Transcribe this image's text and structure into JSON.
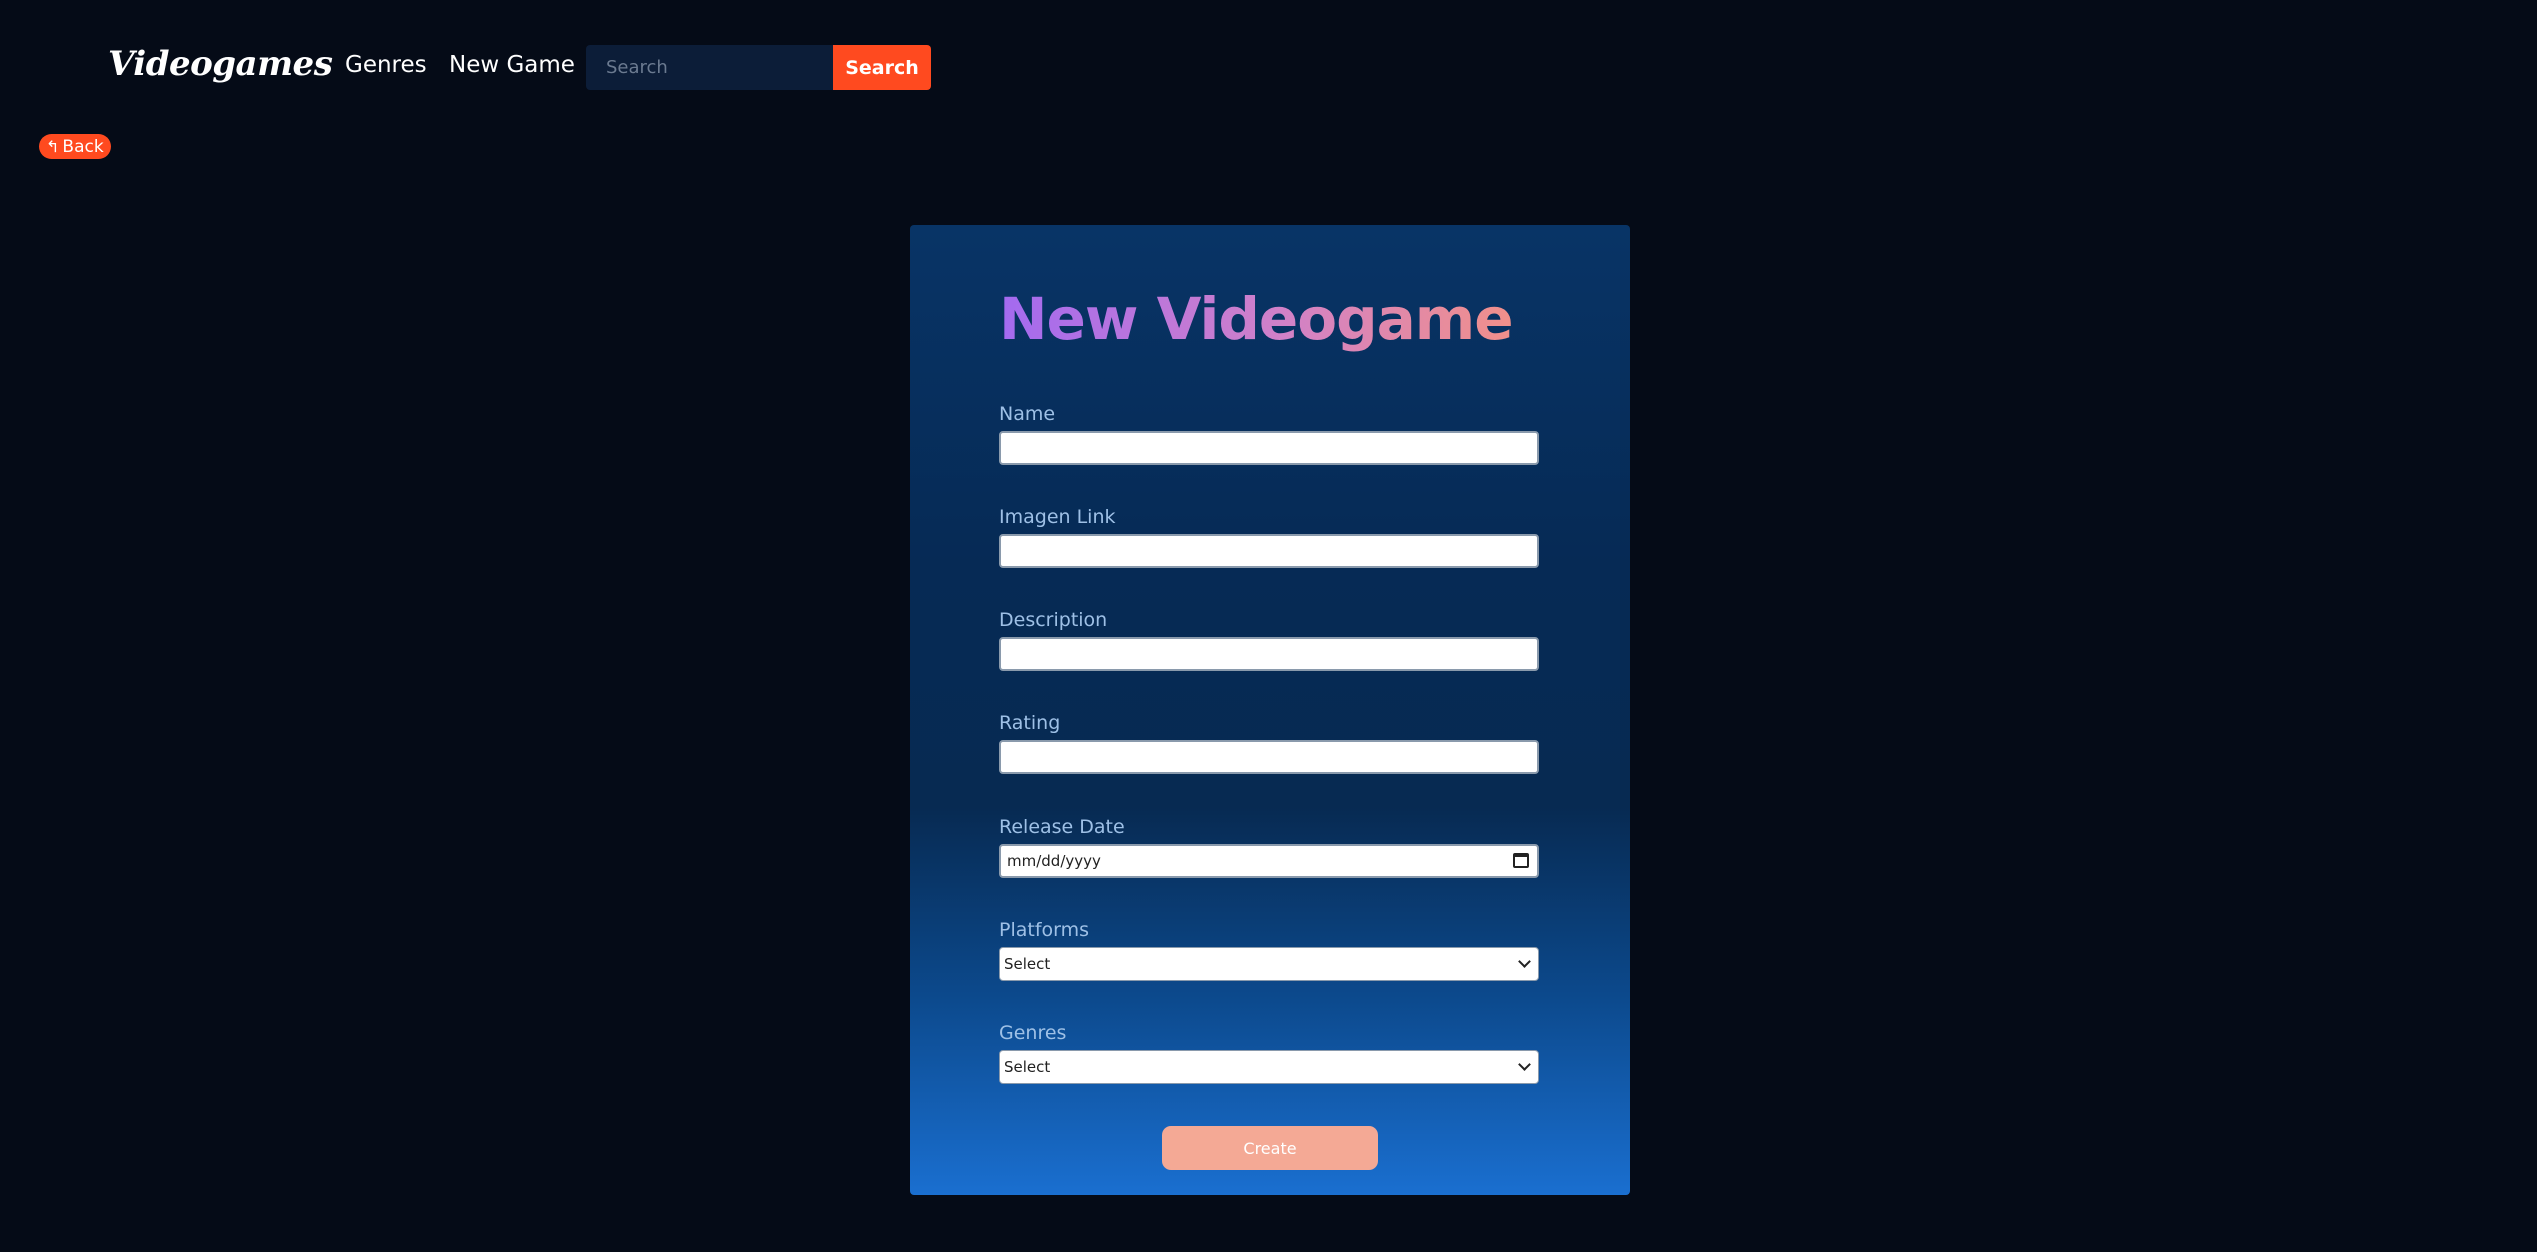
{
  "navbar": {
    "logo": "Videogames",
    "links": [
      {
        "label": "Genres"
      },
      {
        "label": "New Game"
      }
    ],
    "search": {
      "placeholder": "Search",
      "value": "",
      "button_label": "Search"
    }
  },
  "back": {
    "icon": "reply-arrow-icon",
    "label": "Back"
  },
  "form": {
    "title": "New Videogame",
    "title_gradient": [
      "#a36af0",
      "#f1908a"
    ],
    "fields": [
      {
        "label": "Name",
        "value": ""
      },
      {
        "label": "Imagen Link",
        "value": ""
      },
      {
        "label": "Description",
        "value": ""
      },
      {
        "label": "Rating",
        "value": ""
      },
      {
        "label": "Release Date",
        "placeholder": "mm/dd/yyyy"
      },
      {
        "label": "Platforms",
        "selected": "Select"
      },
      {
        "label": "Genres",
        "selected": "Select"
      }
    ],
    "submit_label": "Create"
  },
  "colors": {
    "background": "#050b17",
    "accent": "#ff4a1f",
    "button_disabled": "#f4a995",
    "label": "#9ec0e6"
  }
}
